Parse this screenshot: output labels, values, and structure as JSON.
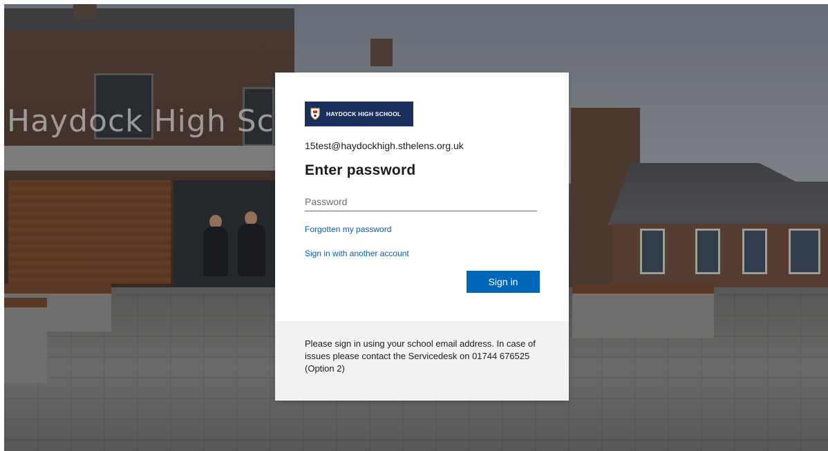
{
  "background": {
    "sign_text": "Haydock High Sch"
  },
  "card": {
    "logo": {
      "text": "HAYDOCK HIGH SCHOOL",
      "icon": "school-crest-icon",
      "bg_color": "#1b2f5c"
    },
    "identity": "15test@haydockhigh.sthelens.org.uk",
    "title": "Enter password",
    "password": {
      "value": "",
      "placeholder": "Password"
    },
    "forgot_link": "Forgotten my password",
    "other_account_link": "Sign in with another account",
    "signin_button": "Sign in",
    "accent_color": "#0067b8",
    "footer_text": "Please sign in using your school email address. In case of issues please contact the Servicedesk on 01744 676525 (Option 2)"
  }
}
